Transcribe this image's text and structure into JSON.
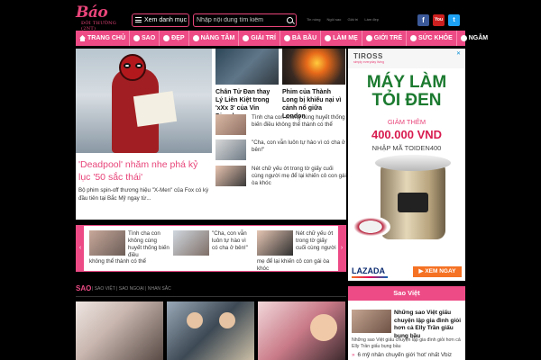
{
  "header": {
    "logo_text": "Báo",
    "logo_sub": "ĐỜI THƯỜNG (2NT)",
    "menu_button": "Xem danh mục",
    "search_placeholder": "Nhập nội dung tìm kiếm",
    "top_links": [
      "Tin nóng",
      "Ngôi sao",
      "Giải trí",
      "Làm đẹp"
    ],
    "social": [
      {
        "name": "facebook",
        "glyph": "f",
        "color": "#3b5998"
      },
      {
        "name": "youtube",
        "glyph": "You",
        "color": "#cc1f1f"
      },
      {
        "name": "twitter",
        "glyph": "t",
        "color": "#1da1f2"
      }
    ]
  },
  "nav": {
    "items": [
      "TRANG CHỦ",
      "SAO",
      "ĐẸP",
      "NÀNG TÂM",
      "GIẢI TRÍ",
      "BÀ BẦU",
      "LÀM MẸ",
      "GIỚI TRẺ",
      "SỨC KHỎE",
      "NGẪM"
    ],
    "color": "#ed4b85"
  },
  "featured": {
    "title": "'Deadpool' nhăm nhe phá kỷ lục '50 sắc thái'",
    "desc": "Bộ phim spin-off thương hiệu \"X-Men\" của Fox có kỳ đầu tiên tại Bắc Mỹ ngay từ..."
  },
  "top_articles": [
    {
      "title": "Chân Tử Đan thay Lý Liên Kiệt trong 'xXx 3' của Vin Diesel"
    },
    {
      "title": "Phim của Thành Long bị khiếu nại vì cảnh nổ giữa London"
    }
  ],
  "small_articles": [
    {
      "text": "Tình cha con không cùng huyết thống biến điều không thể thành có thể"
    },
    {
      "text": "\"Cha, con vẫn luôn tự hào vì có cha ở bên!\""
    },
    {
      "text": "Nét chữ yếu ớt trong tờ giấy cuối cùng người mẹ để lại khiến cô con gái òa khóc"
    }
  ],
  "carousel": {
    "prev": "‹",
    "next": "›",
    "items": [
      {
        "text": "Tình cha con không cùng huyết thống biến điều",
        "text2": "không thể thành có thể"
      },
      {
        "text": "\"Cha, con vẫn luôn tự hào vì có cha ở bên!\"",
        "text2": ""
      },
      {
        "text": "Nét chữ yếu ớt trong tờ giấy cuối cùng người",
        "text2": "mẹ để lại khiến cô con gái òa khóc"
      }
    ]
  },
  "ad": {
    "brand": "TIROSS",
    "brand_tag": "simply everyday living",
    "close": "✕",
    "headline1": "MÁY LÀM",
    "headline2": "TỎI ĐEN",
    "discount_label": "GIẢM THÊM",
    "price": "400.000 VND",
    "code_text": "NHẬP MÃ TOIDEN400",
    "store": "LAZADA",
    "cta": "▶ XEM NGAY"
  },
  "sao_viet": {
    "heading": "Sao Việt",
    "title": "Những sao Việt giấu chuyện lập gia đình giỏi hơn cả Elly Trần giấu bụng bầu",
    "desc": "Những sao Việt giấu chuyện lập gia đình giỏi hơn cả Elly Trần giấu bụng bầu",
    "more_bullet": "»",
    "more": "6 mỹ nhân chuyển giới 'hot' nhất Vbiz"
  },
  "section": {
    "title": "SAO",
    "sub": "| SAO VIỆT | SAO NGOẠI | NHAN SẮC"
  }
}
